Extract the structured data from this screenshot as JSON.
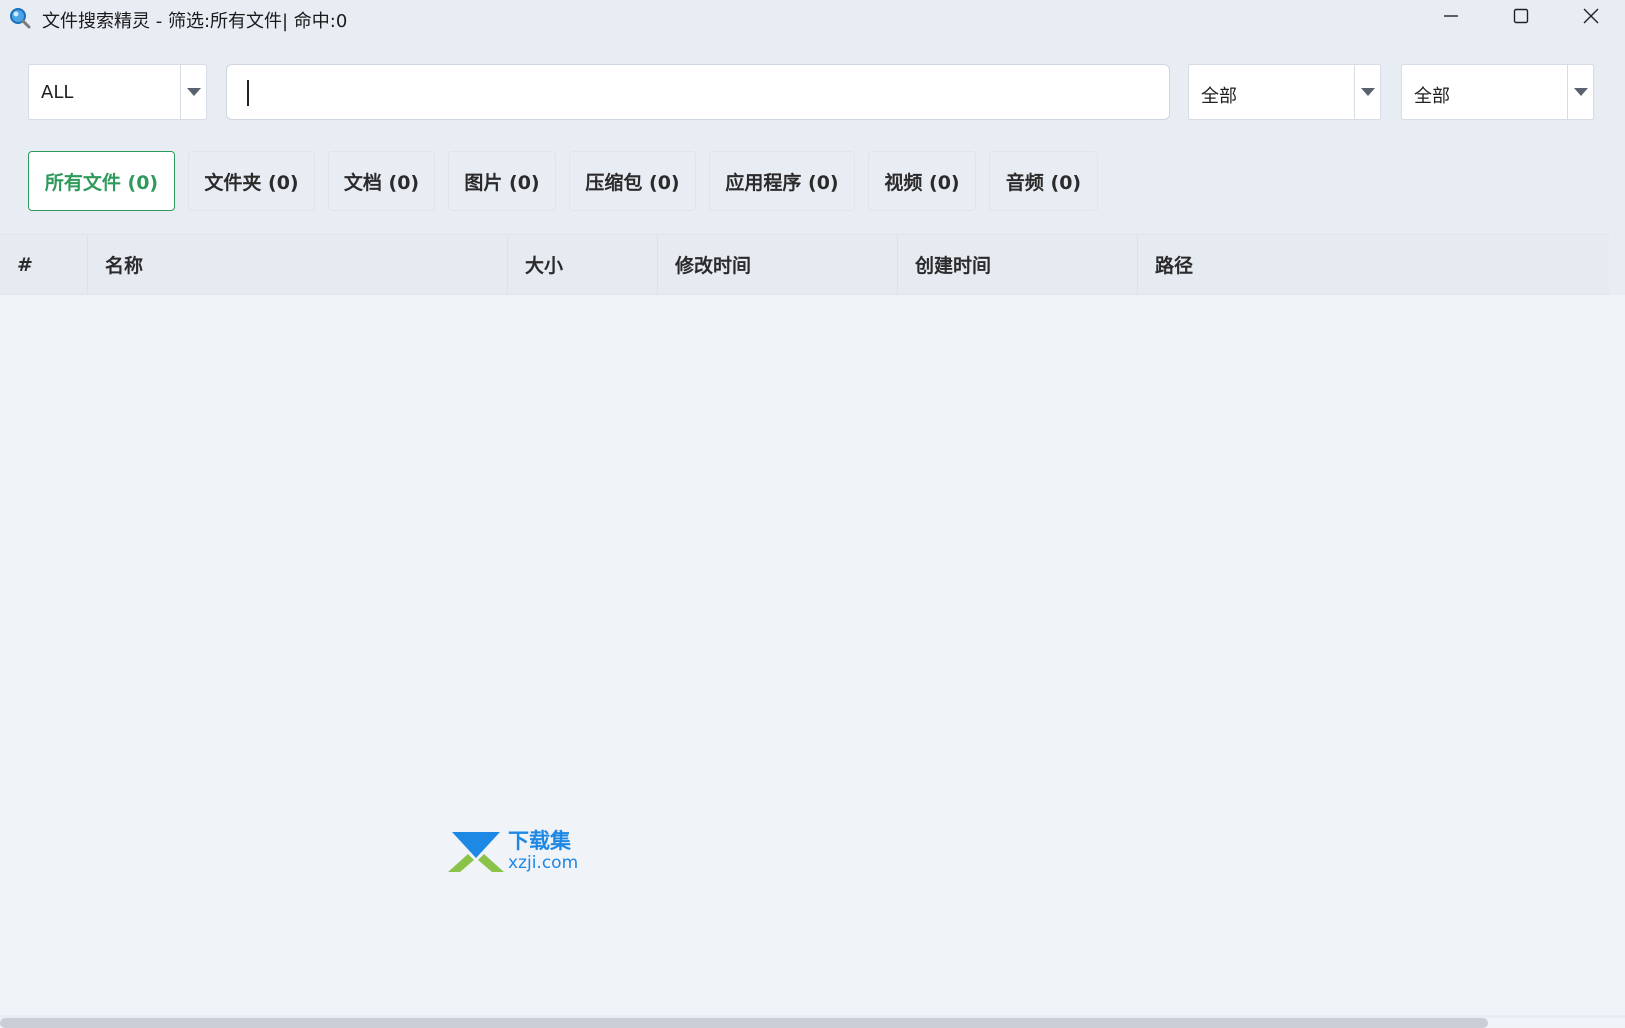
{
  "window": {
    "title": "文件搜索精灵 - 筛选:所有文件| 命中:0",
    "icon": "magnifier-app-icon",
    "controls": [
      "minimize-icon",
      "maximize-icon",
      "close-icon"
    ]
  },
  "toolbar": {
    "type_select": {
      "value": "ALL"
    },
    "search": {
      "value": "",
      "placeholder": ""
    },
    "filter_select_1": {
      "value": "全部"
    },
    "filter_select_2": {
      "value": "全部"
    }
  },
  "tabs": [
    {
      "label": "所有文件 (0)",
      "active": true
    },
    {
      "label": "文件夹 (0)",
      "active": false
    },
    {
      "label": "文档 (0)",
      "active": false
    },
    {
      "label": "图片 (0)",
      "active": false
    },
    {
      "label": "压缩包 (0)",
      "active": false
    },
    {
      "label": "应用程序 (0)",
      "active": false
    },
    {
      "label": "视频 (0)",
      "active": false
    },
    {
      "label": "音频 (0)",
      "active": false
    }
  ],
  "table": {
    "columns": [
      "#",
      "名称",
      "大小",
      "修改时间",
      "创建时间",
      "路径"
    ],
    "rows": []
  },
  "watermark": {
    "name": "下载集",
    "domain": "xzji.com"
  },
  "colors": {
    "accent": "#2e9a5c",
    "background": "#e8edf4",
    "table_body": "#f0f3f7",
    "watermark_blue": "#1e88e5",
    "watermark_green": "#8bc34a"
  }
}
